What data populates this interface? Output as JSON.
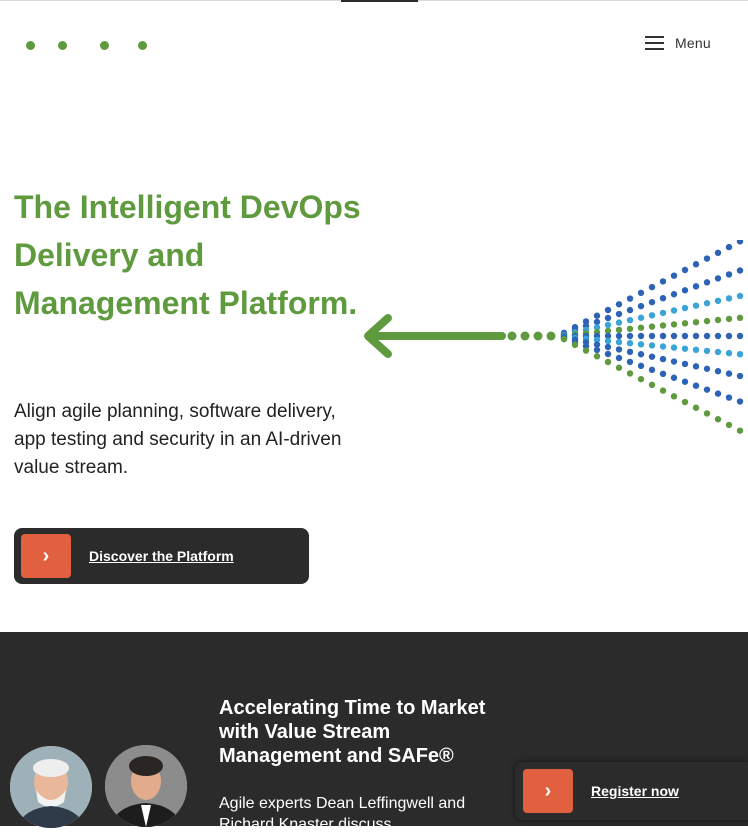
{
  "header": {
    "menu_label": "Menu"
  },
  "hero": {
    "title": "The Intelligent DevOps Delivery and Management Platform.",
    "subtitle": "Align agile planning, software delivery, app testing and security in an AI-driven value stream.",
    "cta_label": "Discover the Platform"
  },
  "event": {
    "title": "Accelerating Time to Market with Value Stream Management and SAFe®",
    "description": "Agile experts Dean Leffingwell and Richard Knaster discuss",
    "register_label": "Register now"
  },
  "colors": {
    "brand_green": "#5f9a3f",
    "accent_orange": "#e0603f",
    "dark_bg": "#2b2b2b",
    "dot_blue": "#2d63b5",
    "dot_cyan": "#3aa3d8"
  },
  "icons": {
    "menu": "hamburger-icon",
    "cta": "chevron-right-icon",
    "graphic": "arrow-left-icon"
  }
}
